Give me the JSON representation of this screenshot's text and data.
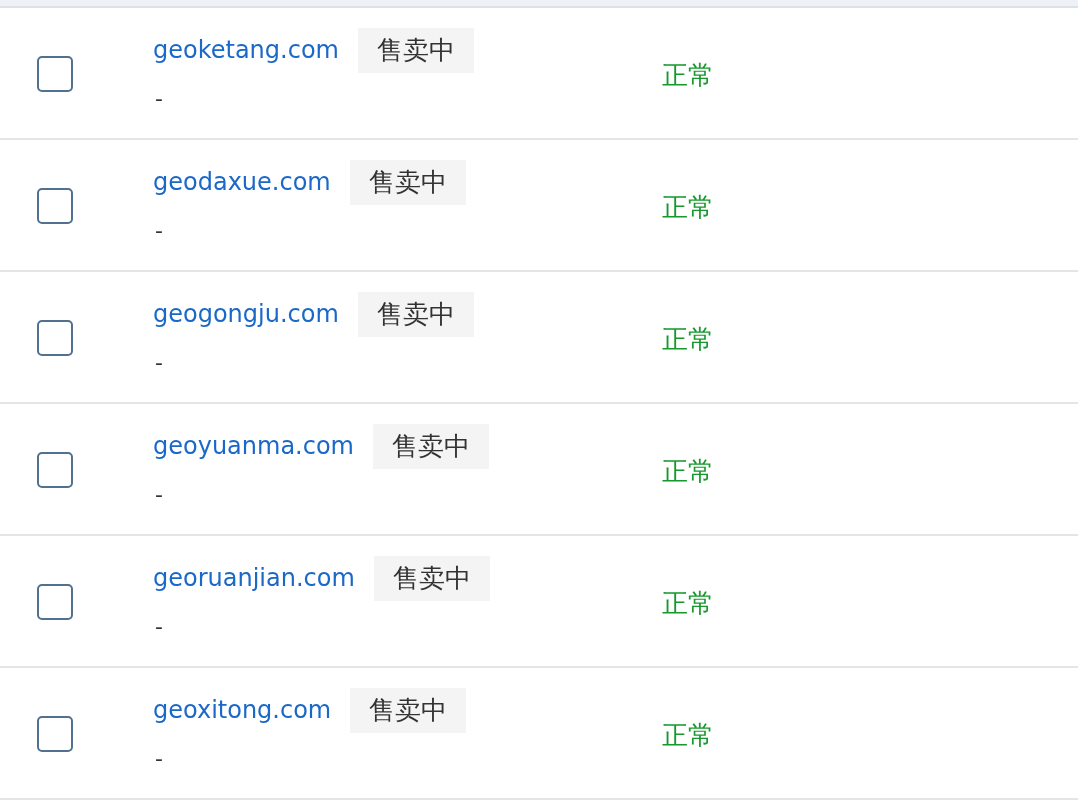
{
  "table": {
    "rows": [
      {
        "checked": false,
        "domain": "geoketang.com",
        "badge": "售卖中",
        "note": "-",
        "status": "正常"
      },
      {
        "checked": false,
        "domain": "geodaxue.com",
        "badge": "售卖中",
        "note": "-",
        "status": "正常"
      },
      {
        "checked": false,
        "domain": "geogongju.com",
        "badge": "售卖中",
        "note": "-",
        "status": "正常"
      },
      {
        "checked": false,
        "domain": "geoyuanma.com",
        "badge": "售卖中",
        "note": "-",
        "status": "正常"
      },
      {
        "checked": false,
        "domain": "georuanjian.com",
        "badge": "售卖中",
        "note": "-",
        "status": "正常"
      },
      {
        "checked": false,
        "domain": "geoxitong.com",
        "badge": "售卖中",
        "note": "-",
        "status": "正常"
      }
    ]
  }
}
